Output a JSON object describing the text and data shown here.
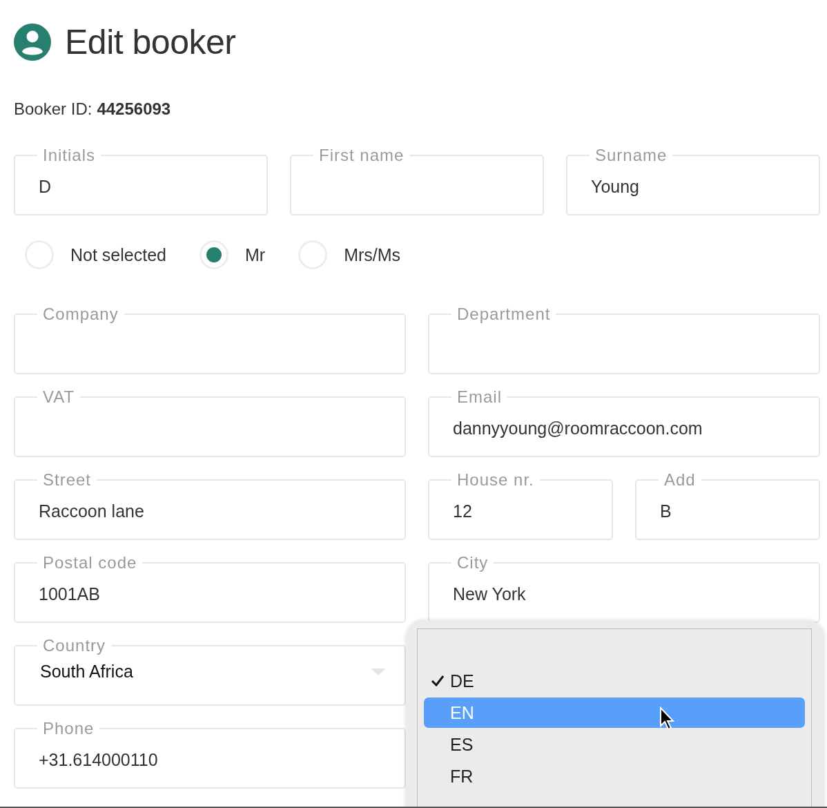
{
  "header": {
    "title": "Edit booker"
  },
  "booker_id": {
    "label": "Booker ID:",
    "value": "44256093"
  },
  "name_fields": [
    {
      "label": "Initials",
      "value": "D"
    },
    {
      "label": "First name"
    },
    {
      "label": "Surname",
      "value": "Young"
    }
  ],
  "salutation": [
    {
      "label": "Not selected",
      "selected": false
    },
    {
      "label": "Mr",
      "selected": true
    },
    {
      "label": "Mrs/Ms",
      "selected": false
    }
  ],
  "rows": [
    [
      {
        "label": "Company",
        "kind": "text"
      },
      {
        "label": "Department",
        "kind": "text"
      }
    ],
    [
      {
        "label": "VAT",
        "kind": "text"
      },
      {
        "label": "Email",
        "value": "dannyyoung@roomraccoon.com",
        "kind": "text"
      }
    ],
    [
      {
        "label": "Street",
        "value": "Raccoon lane",
        "kind": "text"
      },
      {
        "label": "House nr.",
        "value": "12",
        "kind": "text"
      },
      {
        "label": "Add",
        "value": "B",
        "kind": "text"
      }
    ],
    [
      {
        "label": "Postal code",
        "value": "1001AB",
        "kind": "text"
      },
      {
        "label": "City",
        "value": "New York",
        "kind": "text"
      }
    ],
    [
      {
        "label": "Country",
        "value": "South Africa",
        "kind": "select"
      }
    ],
    [
      {
        "label": "Phone",
        "value": "+31.614000110",
        "kind": "text"
      }
    ]
  ],
  "language_menu": {
    "items": [
      {
        "label": "DE",
        "selected": true,
        "hovered": false
      },
      {
        "label": "EN",
        "selected": false,
        "hovered": true
      },
      {
        "label": "ES",
        "selected": false,
        "hovered": false
      },
      {
        "label": "FR",
        "selected": false,
        "hovered": false
      }
    ]
  }
}
